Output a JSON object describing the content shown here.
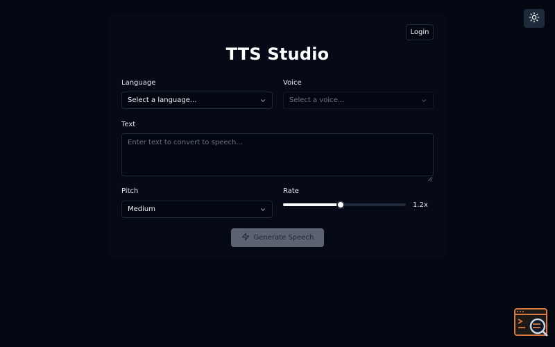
{
  "header": {
    "login_label": "Login",
    "theme_toggle_icon": "sun-icon"
  },
  "main": {
    "title": "TTS Studio",
    "language": {
      "label": "Language",
      "value": "Select a language..."
    },
    "voice": {
      "label": "Voice",
      "placeholder": "Select a voice...",
      "disabled": true
    },
    "text": {
      "label": "Text",
      "placeholder": "Enter text to convert to speech...",
      "value": ""
    },
    "pitch": {
      "label": "Pitch",
      "value": "Medium"
    },
    "rate": {
      "label": "Rate",
      "value_display": "1.2x",
      "fraction": 0.47
    },
    "generate_button": {
      "label": "Generate Speech",
      "icon": "zap-icon",
      "disabled": true
    }
  },
  "widget": {
    "icon": "terminal-search-icon"
  },
  "colors": {
    "background": "#030712",
    "border": "#1f2937",
    "button_disabled": "#6b7280",
    "widget_accent": "#d97745"
  }
}
